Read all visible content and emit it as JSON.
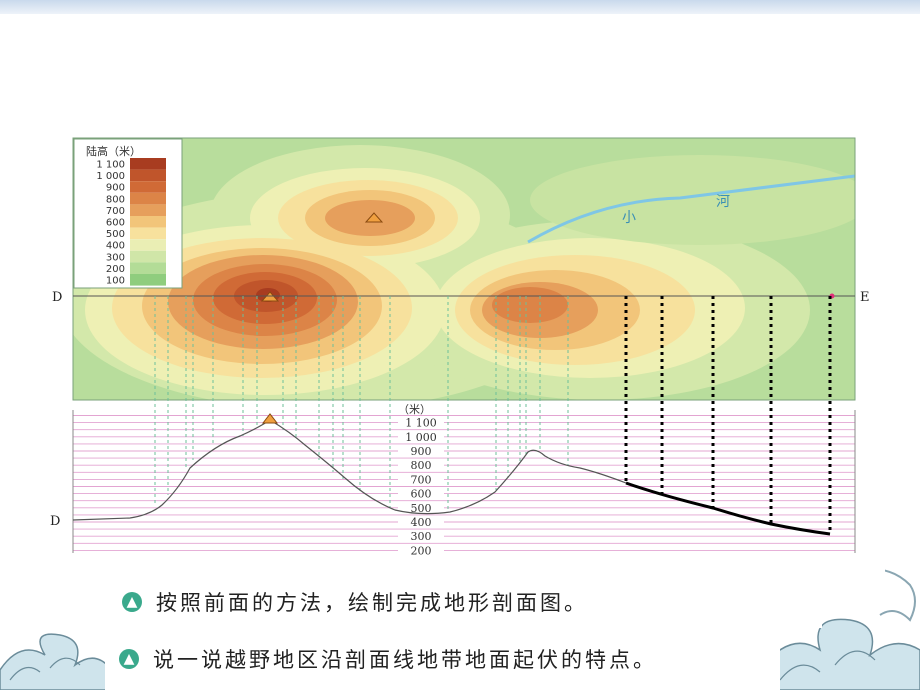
{
  "legend": {
    "title": "陆高（米）",
    "levels": [
      "1 100",
      "1 000",
      "900",
      "800",
      "700",
      "600",
      "500",
      "400",
      "300",
      "200",
      "100"
    ],
    "colors": [
      "#a83c20",
      "#c0552b",
      "#d06a36",
      "#dc8447",
      "#e69f5c",
      "#f2c57a",
      "#f7e19d",
      "#eaeeb4",
      "#d0e6a8",
      "#b3dc97",
      "#8fcd7e"
    ]
  },
  "map": {
    "label_start": "D",
    "label_end": "E",
    "river_label_1": "小",
    "river_label_2": "河"
  },
  "profile": {
    "unit_label": "（米）",
    "ticks": [
      "1 100",
      "1 000",
      "900",
      "800",
      "700",
      "600",
      "500",
      "400",
      "300",
      "200"
    ],
    "label_start": "D"
  },
  "instructions": [
    {
      "text": "按照前面的方法，绘制完成地形剖面图。"
    },
    {
      "text": "说一说越野地区沿剖面线地带地面起伏的特点。"
    }
  ],
  "colors": {
    "river": "#7fc6e6",
    "profile_grid": "#e3a4d2",
    "guide_lines": "#6cbf9a",
    "accent": "#3aa98c"
  }
}
